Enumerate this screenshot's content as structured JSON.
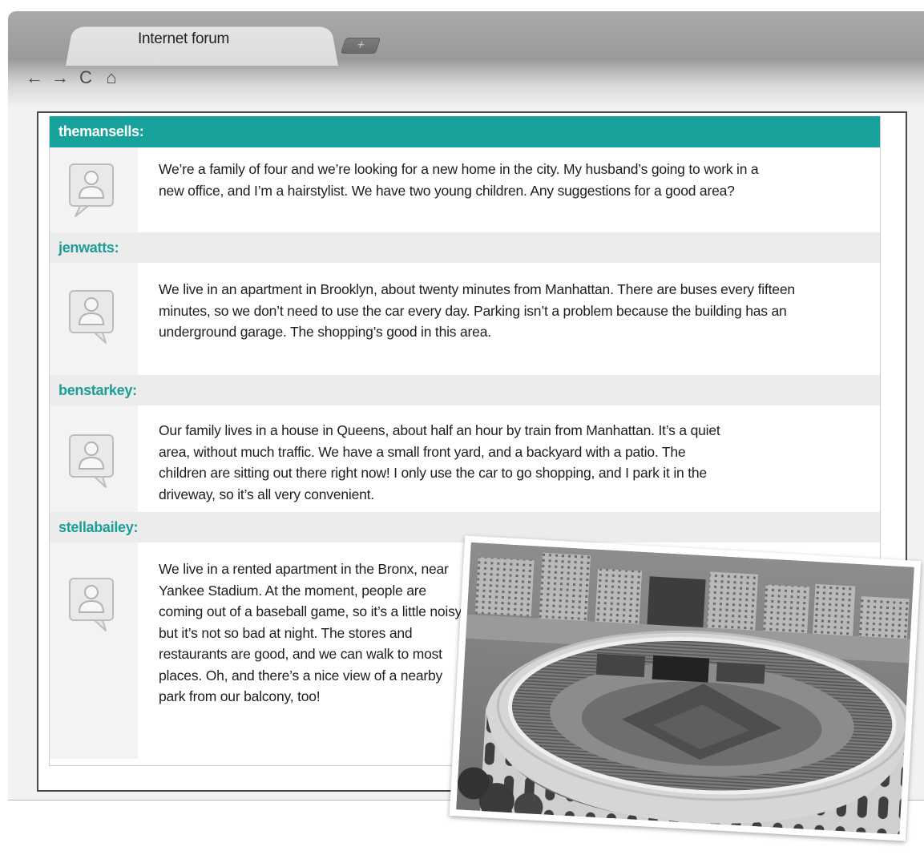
{
  "browser": {
    "tab_title": "Internet forum",
    "new_tab_label": "+",
    "nav": {
      "back": "←",
      "forward": "→",
      "reload": "C",
      "home": "⌂"
    }
  },
  "forum": {
    "header_color": "#17a39b",
    "username_color": "#1a9e98",
    "posts": [
      {
        "username": "themansells:",
        "text": "We’re a family of four and we’re looking for a new home in the city. My husband’s going to work in a new office, and I’m a hairstylist. We have two young children. Any suggestions for a good area?"
      },
      {
        "username": "jenwatts:",
        "text": "We live in an apartment in Brooklyn, about twenty minutes from Manhattan. There are buses every fifteen minutes, so we don’t need to use the car every day. Parking isn’t a problem because the building has an underground garage. The shopping’s good in this area."
      },
      {
        "username": "benstarkey:",
        "text": "Our family lives in a house in Queens, about half an hour by train from Manhattan. It’s a quiet area, without much traffic. We have a small front yard, and a backyard with a patio. The children are sitting out there right now! I only use the car to go shopping, and I park it in the driveway, so it’s all very convenient."
      },
      {
        "username": "stellabailey:",
        "text": "We live in a rented apartment in the Bronx, near Yankee Stadium. At the moment, people are coming out of a baseball game, so it’s a little noisy, but it’s not so bad at night. The stores and restaurants are good, and we can walk to most places. Oh, and there’s a nice view of a nearby park from our balcony, too!"
      }
    ]
  },
  "photo": {
    "subject": "aerial-stadium-photo"
  }
}
